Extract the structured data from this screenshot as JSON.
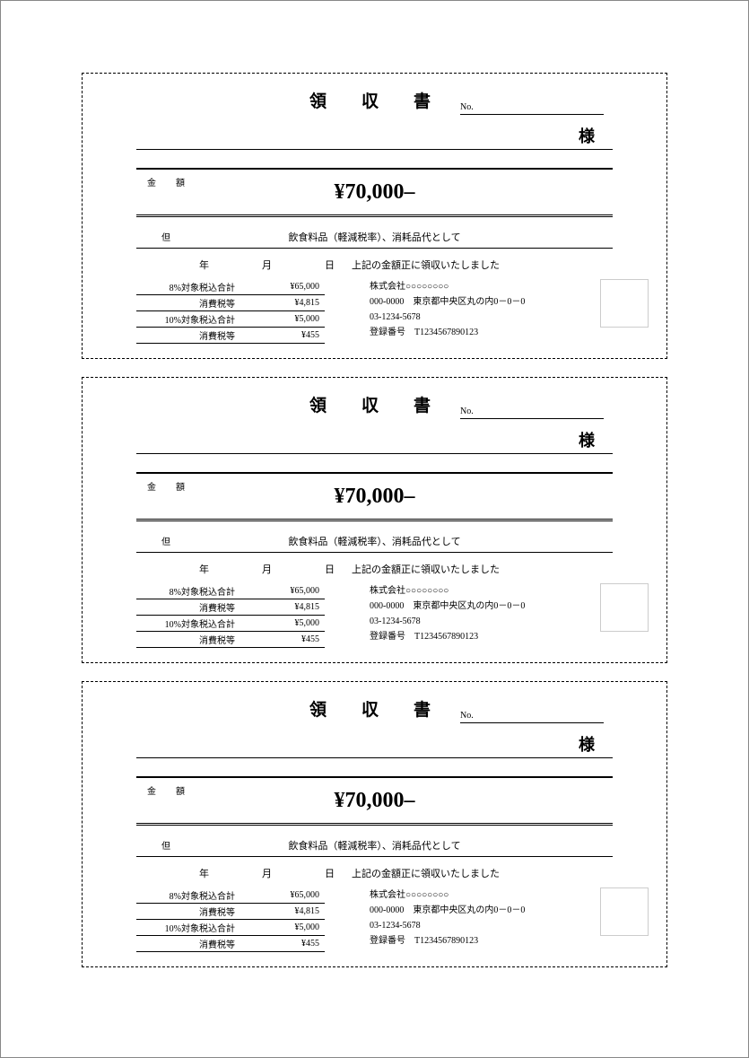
{
  "receipt": {
    "title": "領　収　書",
    "no_label": "No.",
    "sama": "様",
    "amount_label": "金　額",
    "amount_value": "¥70,000–",
    "memo_label": "但",
    "memo_text": "飲食料品（軽減税率）、消耗品代として",
    "date_year_label": "年",
    "date_month_label": "月",
    "date_day_label": "日",
    "ack_text": "上記の金額正に領収いたしました",
    "tax_rows": [
      {
        "label": "8%対象税込合計",
        "value": "¥65,000"
      },
      {
        "label": "消費税等",
        "value": "¥4,815"
      },
      {
        "label": "10%対象税込合計",
        "value": "¥5,000"
      },
      {
        "label": "消費税等",
        "value": "¥455"
      }
    ],
    "issuer": {
      "name": "株式会社○○○○○○○○",
      "address": "000-0000　東京都中央区丸の内0－0－0",
      "tel": "03-1234-5678",
      "reg": "登録番号　T1234567890123"
    }
  }
}
